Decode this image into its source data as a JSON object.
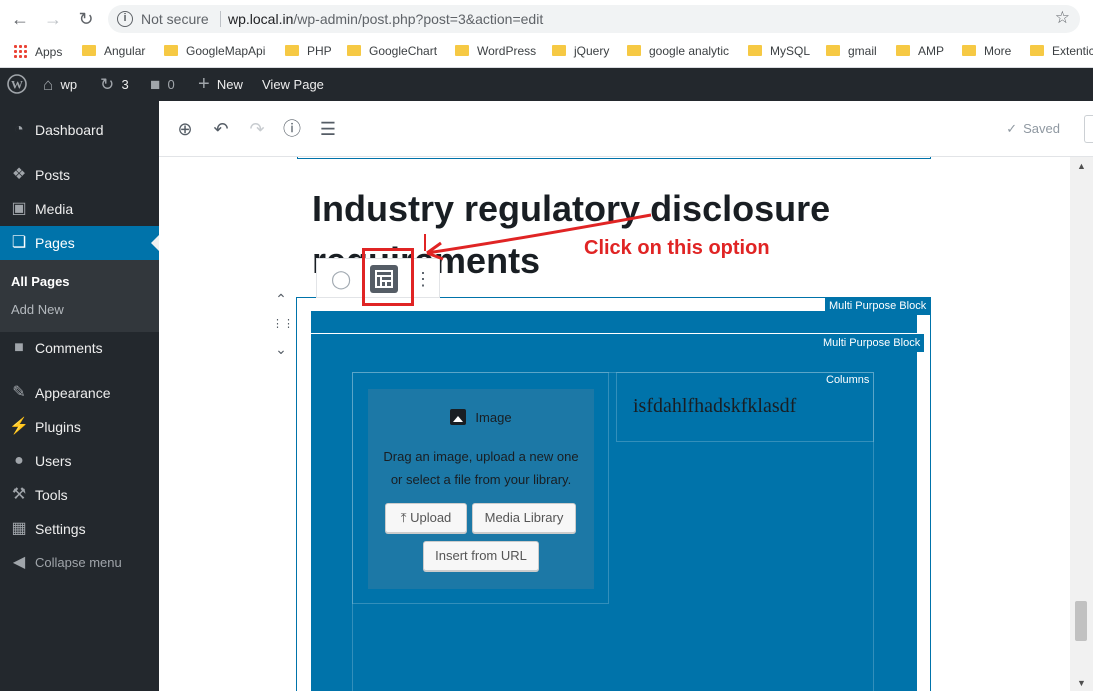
{
  "browser": {
    "not_secure": "Not secure",
    "url_host": "wp.local.in",
    "url_path": "/wp-admin/post.php?post=3&action=edit",
    "bookmarks": [
      "Apps",
      "Angular",
      "GoogleMapApi",
      "PHP",
      "GoogleChart",
      "WordPress",
      "jQuery",
      "google analytic",
      "MySQL",
      "gmail",
      "AMP",
      "More",
      "Extentic"
    ]
  },
  "adminbar": {
    "site_name": "wp",
    "updates_count": "3",
    "comments_count": "0",
    "new_label": "New",
    "view_page": "View Page"
  },
  "sidebar": {
    "items": [
      {
        "label": "Dashboard",
        "icon": "dashboard-icon"
      },
      {
        "label": "Posts",
        "icon": "pin-icon"
      },
      {
        "label": "Media",
        "icon": "media-icon"
      },
      {
        "label": "Pages",
        "icon": "pages-icon"
      },
      {
        "label": "Comments",
        "icon": "comment-icon"
      },
      {
        "label": "Appearance",
        "icon": "brush-icon"
      },
      {
        "label": "Plugins",
        "icon": "plugin-icon"
      },
      {
        "label": "Users",
        "icon": "user-icon"
      },
      {
        "label": "Tools",
        "icon": "wrench-icon"
      },
      {
        "label": "Settings",
        "icon": "settings-icon"
      }
    ],
    "submenu": [
      "All Pages",
      "Add New"
    ],
    "collapse": "Collapse menu"
  },
  "editor": {
    "saved": "Saved",
    "title": "Industry regulatory disclosure requirements",
    "annotation": "Click on this option",
    "block_labels": {
      "outer": "Multi Purpose Block",
      "inner": "Multi Purpose Block",
      "columns": "Columns"
    },
    "image_block": {
      "title": "Image",
      "description": "Drag an image, upload a new one or select a file from your library.",
      "upload": "Upload",
      "media_library": "Media Library",
      "insert_url": "Insert from URL"
    },
    "column_text": "isfdahlfhadskfklasdf"
  },
  "colors": {
    "admin_dark": "#23282d",
    "wp_blue": "#0073aa",
    "annotation_red": "#e02424"
  }
}
